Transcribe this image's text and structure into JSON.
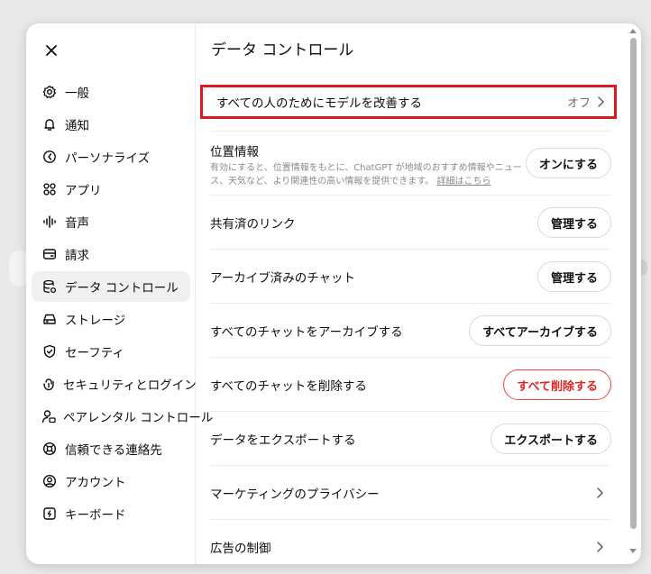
{
  "dialog": {
    "close_icon": "close-icon"
  },
  "sidebar": {
    "items": [
      {
        "label": "一般",
        "icon": "gear-icon"
      },
      {
        "label": "通知",
        "icon": "bell-icon"
      },
      {
        "label": "パーソナライズ",
        "icon": "personalize-icon"
      },
      {
        "label": "アプリ",
        "icon": "apps-grid-icon"
      },
      {
        "label": "音声",
        "icon": "audio-wave-icon"
      },
      {
        "label": "請求",
        "icon": "billing-card-icon"
      },
      {
        "label": "データ コントロール",
        "icon": "data-control-icon",
        "active": true
      },
      {
        "label": "ストレージ",
        "icon": "storage-drive-icon"
      },
      {
        "label": "セーフティ",
        "icon": "shield-check-icon"
      },
      {
        "label": "セキュリティとログイン",
        "icon": "security-lock-icon"
      },
      {
        "label": "ペアレンタル コントロール",
        "icon": "parental-user-icon"
      },
      {
        "label": "信頼できる連絡先",
        "icon": "trusted-contact-icon"
      },
      {
        "label": "アカウント",
        "icon": "account-icon"
      },
      {
        "label": "キーボード",
        "icon": "keyboard-icon"
      }
    ]
  },
  "main": {
    "title": "データ コントロール",
    "improve_model": {
      "label": "すべての人のためにモデルを改善する",
      "value": "オフ"
    },
    "location": {
      "title": "位置情報",
      "description": "有効にすると、位置情報をもとに、ChatGPT が地域のおすすめ情報やニュース、天気など、より関連性の高い情報を提供できます。",
      "link": "詳細はこちら",
      "button": "オンにする"
    },
    "rows": [
      {
        "label": "共有済のリンク",
        "button": "管理する"
      },
      {
        "label": "アーカイブ済みのチャット",
        "button": "管理する"
      },
      {
        "label": "すべてのチャットをアーカイブする",
        "button": "すべてアーカイブする"
      },
      {
        "label": "すべてのチャットを削除する",
        "button": "すべて削除する",
        "danger": true
      },
      {
        "label": "データをエクスポートする",
        "button": "エクスポートする"
      },
      {
        "label": "マーケティングのプライバシー"
      },
      {
        "label": "広告の制御"
      }
    ]
  },
  "colors": {
    "highlight": "#d8191f",
    "danger": "#e02424",
    "active_nav_bg": "#f0f0f0"
  }
}
